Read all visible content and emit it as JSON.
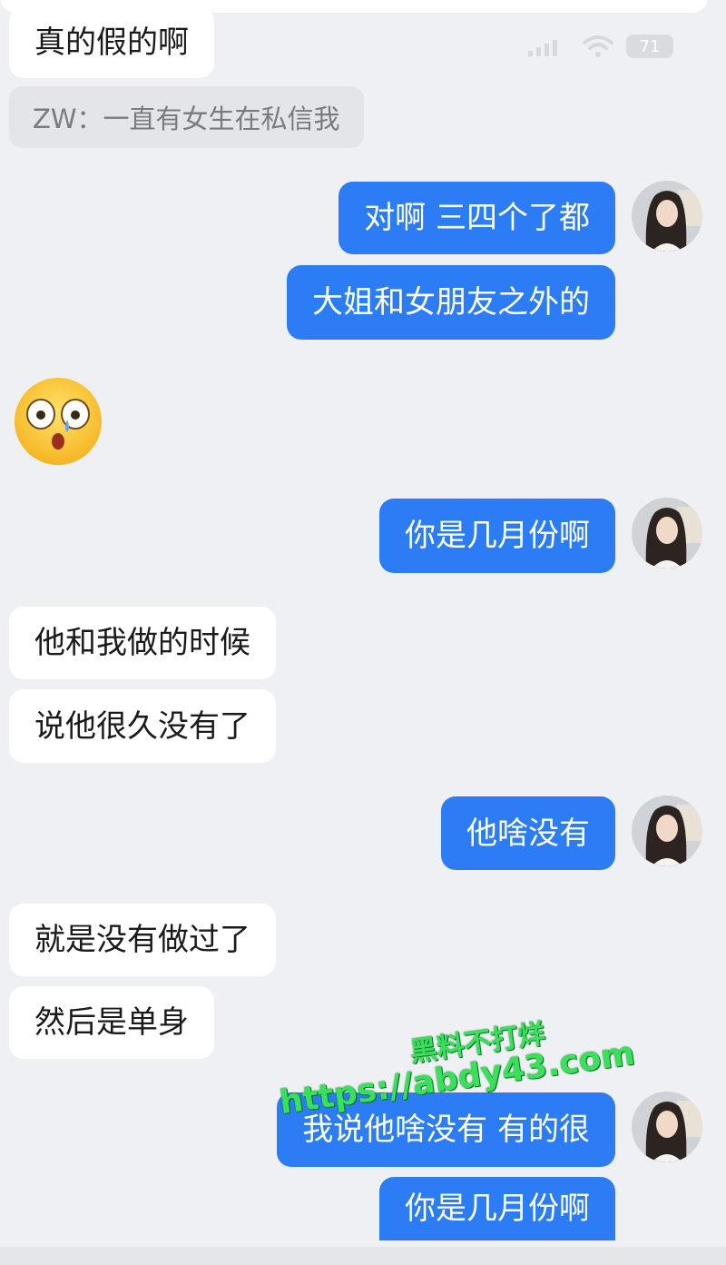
{
  "status_bar": {
    "battery": "71"
  },
  "messages": {
    "m0": "真的假的啊",
    "quote": "ZW：一直有女生在私信我",
    "m1": "对啊 三四个了都",
    "m2": "大姐和女朋友之外的",
    "m3": "你是几月份啊",
    "m4": "他和我做的时候",
    "m5": "说他很久没有了",
    "m6": "他啥没有",
    "m7": "就是没有做过了",
    "m8": "然后是单身",
    "m9": "我说他啥没有 有的很",
    "m10": "你是几月份啊"
  },
  "watermark": {
    "line1": "黑料不打烊",
    "line2": "https://abdy43.com"
  },
  "colors": {
    "blue_bubble": "#2c7cf6",
    "white_bubble": "#ffffff",
    "background": "#eef0f3",
    "watermark": "#39e05a"
  },
  "icons": [
    "signal-icon",
    "wifi-icon",
    "battery-icon",
    "avatar",
    "astonished-emoji"
  ]
}
